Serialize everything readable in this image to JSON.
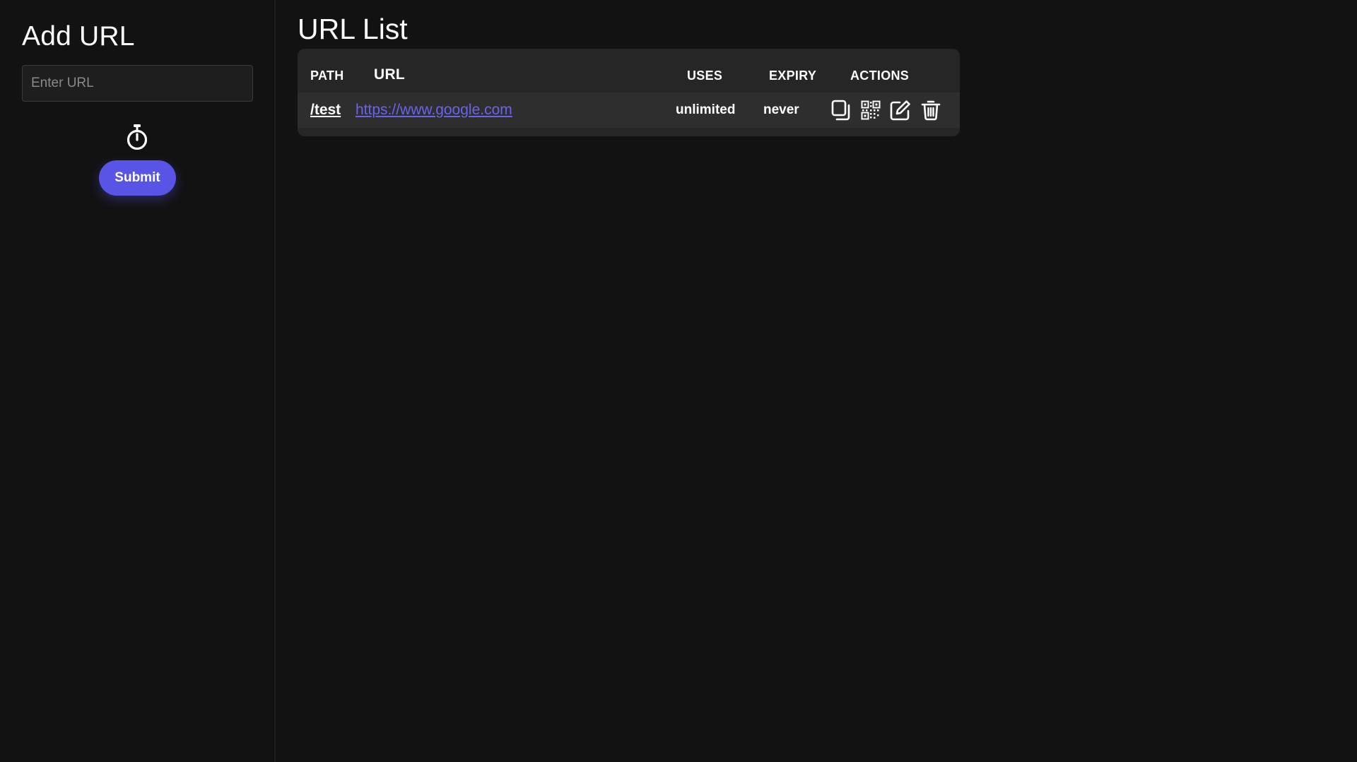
{
  "sidebar": {
    "title": "Add URL",
    "input_placeholder": "Enter URL",
    "input_value": "",
    "timer_icon": "stopwatch-icon",
    "submit_label": "Submit"
  },
  "main": {
    "title": "URL List",
    "columns": {
      "path": "PATH",
      "url": "URL",
      "uses": "USES",
      "expiry": "EXPIRY",
      "actions": "ACTIONS"
    },
    "rows": [
      {
        "path": "/test",
        "url": "https://www.google.com",
        "uses": "unlimited",
        "expiry": "never",
        "actions": [
          "copy-icon",
          "qr-code-icon",
          "edit-icon",
          "trash-icon"
        ]
      }
    ]
  },
  "colors": {
    "background": "#121212",
    "sidebar_input_bg": "#1e1e1e",
    "card_bg": "#262626",
    "row_bg": "#2e2e2e",
    "accent": "#5a54e6",
    "link": "#6b63f0",
    "text": "#ffffff"
  }
}
